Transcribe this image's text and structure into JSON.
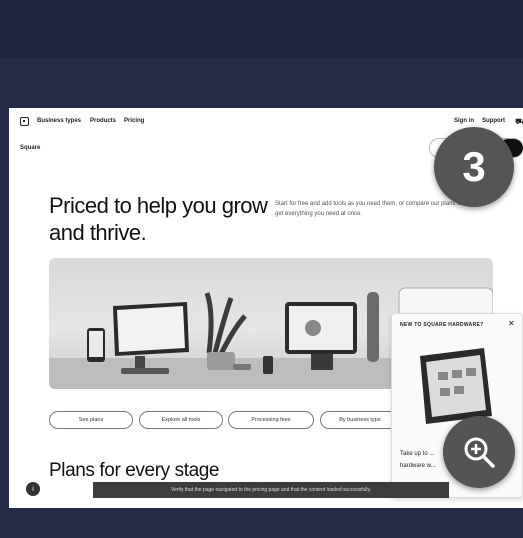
{
  "nav": {
    "links": [
      "Business types",
      "Products",
      "Pricing"
    ],
    "right_links": [
      "Sign in",
      "Support"
    ],
    "brand": "Square"
  },
  "hero": {
    "title": "Priced to help you grow and thrive.",
    "copy": "Start for free and add tools as you need them, or compare our plans to get everything you need at once."
  },
  "pills": [
    "See plans",
    "Explore all tools",
    "Processing fees",
    "By business type"
  ],
  "plans_title": "Plans for every stage",
  "help_badge": "i",
  "popup": {
    "title": "NEW TO SQUARE HARDWARE?",
    "close": "✕",
    "body": "Take up to ... hardware w..."
  },
  "caption": "Verify that the page navigated to the pricing page and that the content loaded successfully.",
  "step_badge": "3",
  "icons": {
    "logo": "square-logo-icon",
    "cart": "cart-icon",
    "zoom": "zoom-in-icon",
    "close": "close-icon"
  },
  "colors": {
    "background": "#1d2138",
    "panel": "#ffffff",
    "badge": "#555555",
    "caption_bg": "#3d3d3d"
  }
}
